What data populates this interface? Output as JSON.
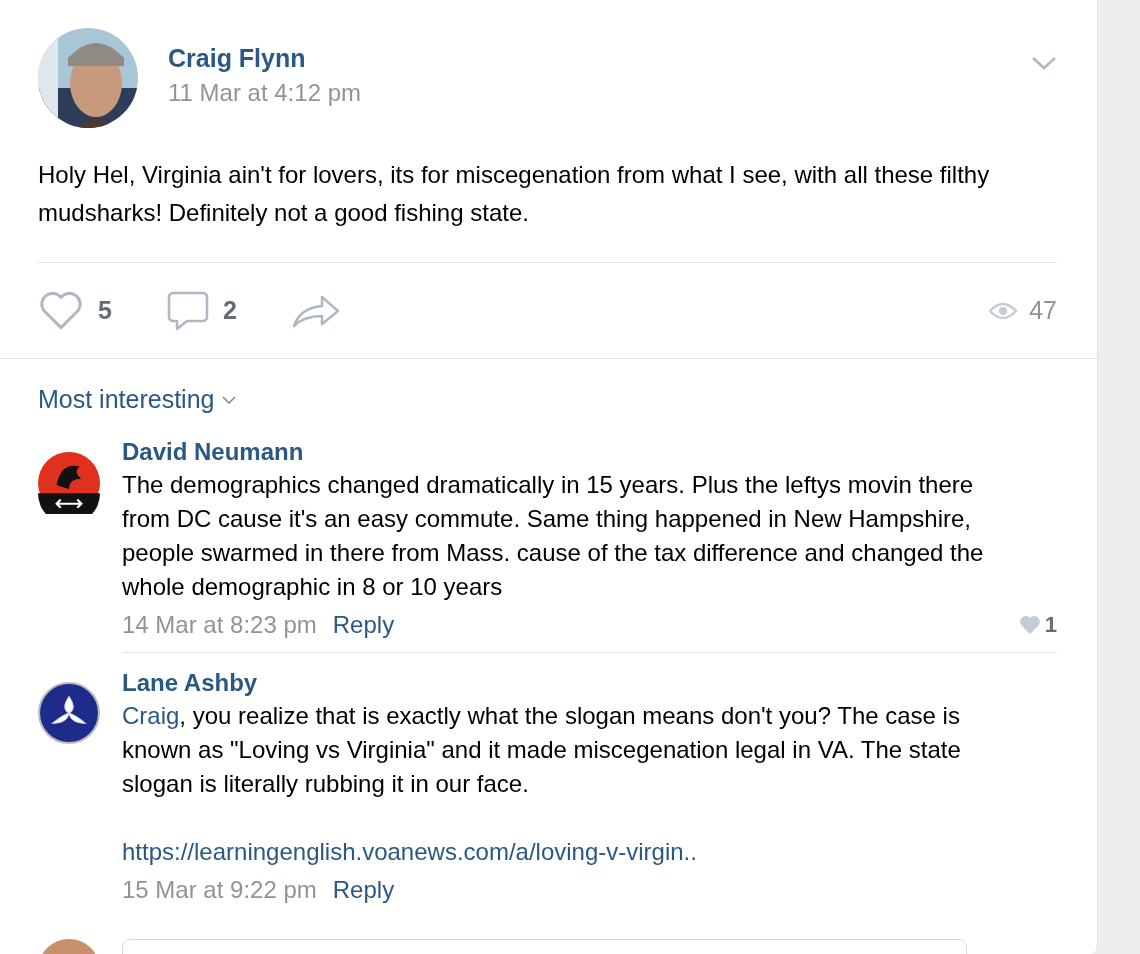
{
  "post": {
    "author": "Craig Flynn",
    "time": "11 Mar at 4:12 pm",
    "text": "Holy Hel, Virginia ain't for lovers, its for miscegenation from what I see, with all these filthy mudsharks! Definitely not a good fishing state.",
    "likes": "5",
    "comments": "2",
    "views": "47"
  },
  "sort": {
    "label": "Most interesting"
  },
  "comments": [
    {
      "author": "David Neumann",
      "kind": "red",
      "paragraphs": [
        "The demographics changed dramatically in 15 years. Plus the leftys movin there from DC cause it's an easy commute. Same thing happened in New Hampshire, people swarmed in there from Mass. cause of the tax difference and changed the whole demographic in 8 or 10 years"
      ],
      "time": "14 Mar at 8:23 pm",
      "reply": "Reply",
      "likes": "1"
    },
    {
      "author": "Lane Ashby",
      "kind": "blue",
      "mention": "Craig",
      "paragraphs": [
        ", you realize that is exactly what the slogan means don't you? The case is known as \"Loving vs Virginia\" and it made miscegenation legal in VA. The state slogan is literally rubbing it in our face."
      ],
      "link": "https://learningenglish.voanews.com/a/loving-v-virgin..",
      "time": "15 Mar at 9:22 pm",
      "reply": "Reply"
    }
  ]
}
